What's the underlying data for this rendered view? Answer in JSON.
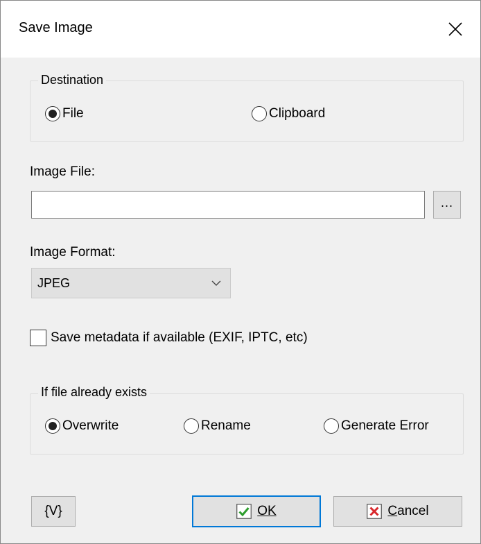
{
  "window": {
    "title": "Save Image"
  },
  "destination": {
    "legend": "Destination",
    "options": [
      {
        "label": "File",
        "selected": true
      },
      {
        "label": "Clipboard",
        "selected": false
      }
    ]
  },
  "image_file": {
    "label": "Image File:",
    "value": "",
    "browse_label": "..."
  },
  "image_format": {
    "label": "Image Format:",
    "selected": "JPEG"
  },
  "metadata": {
    "label": "Save metadata if available (EXIF, IPTC, etc)",
    "checked": false
  },
  "exists": {
    "legend": "If file already exists",
    "options": [
      {
        "label": "Overwrite",
        "selected": true
      },
      {
        "label": "Rename",
        "selected": false
      },
      {
        "label": "Generate Error",
        "selected": false
      }
    ]
  },
  "buttons": {
    "variables_label": "{V}",
    "ok_label": "OK",
    "cancel_label": "Cancel"
  },
  "colors": {
    "dialog_bg": "#f0f0f0",
    "titlebar_bg": "#ffffff",
    "default_button_border": "#0078d7",
    "ok_icon": "#2e9e2e",
    "cancel_icon": "#d9282c"
  },
  "icons": {
    "close": "close-icon",
    "ok": "check-icon",
    "cancel": "x-icon",
    "dropdown": "chevron-down-icon"
  }
}
